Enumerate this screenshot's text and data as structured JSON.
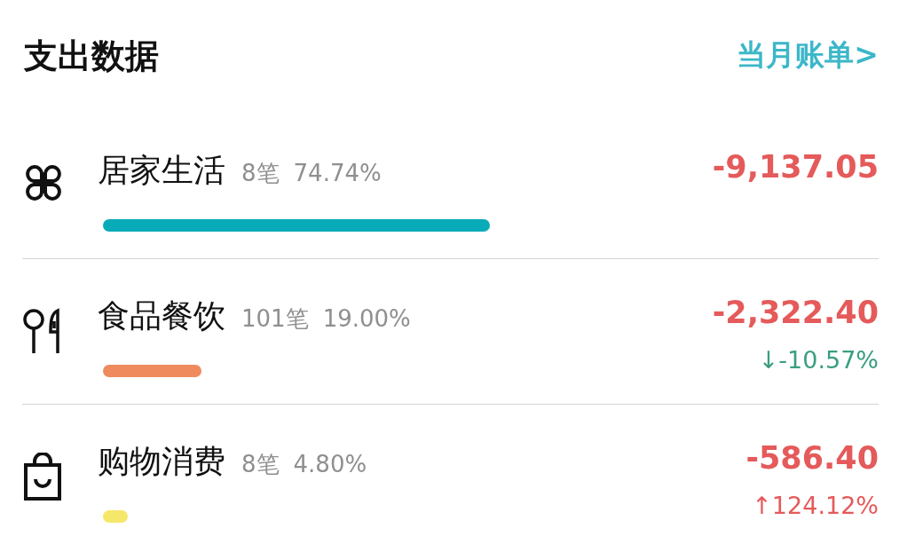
{
  "header": {
    "title": "支出数据",
    "link": "当月账单>"
  },
  "categories": [
    {
      "kind": "clover",
      "name": "居家生活",
      "count": "8笔",
      "share": "74.74%",
      "color": "#0aabb8",
      "amount": "-9,137.05"
    },
    {
      "kind": "cutlery",
      "name": "食品餐饮",
      "count": "101笔",
      "share": "19.00%",
      "color": "#ef8a5e",
      "amount": "-2,322.40",
      "change": {
        "kind": "down",
        "text": "↓-10.57%"
      }
    },
    {
      "kind": "bag",
      "name": "购物消费",
      "count": "8笔",
      "share": "4.80%",
      "color": "#f5e76a",
      "amount": "-586.40",
      "change": {
        "kind": "up",
        "text": "↑124.12%"
      }
    }
  ]
}
